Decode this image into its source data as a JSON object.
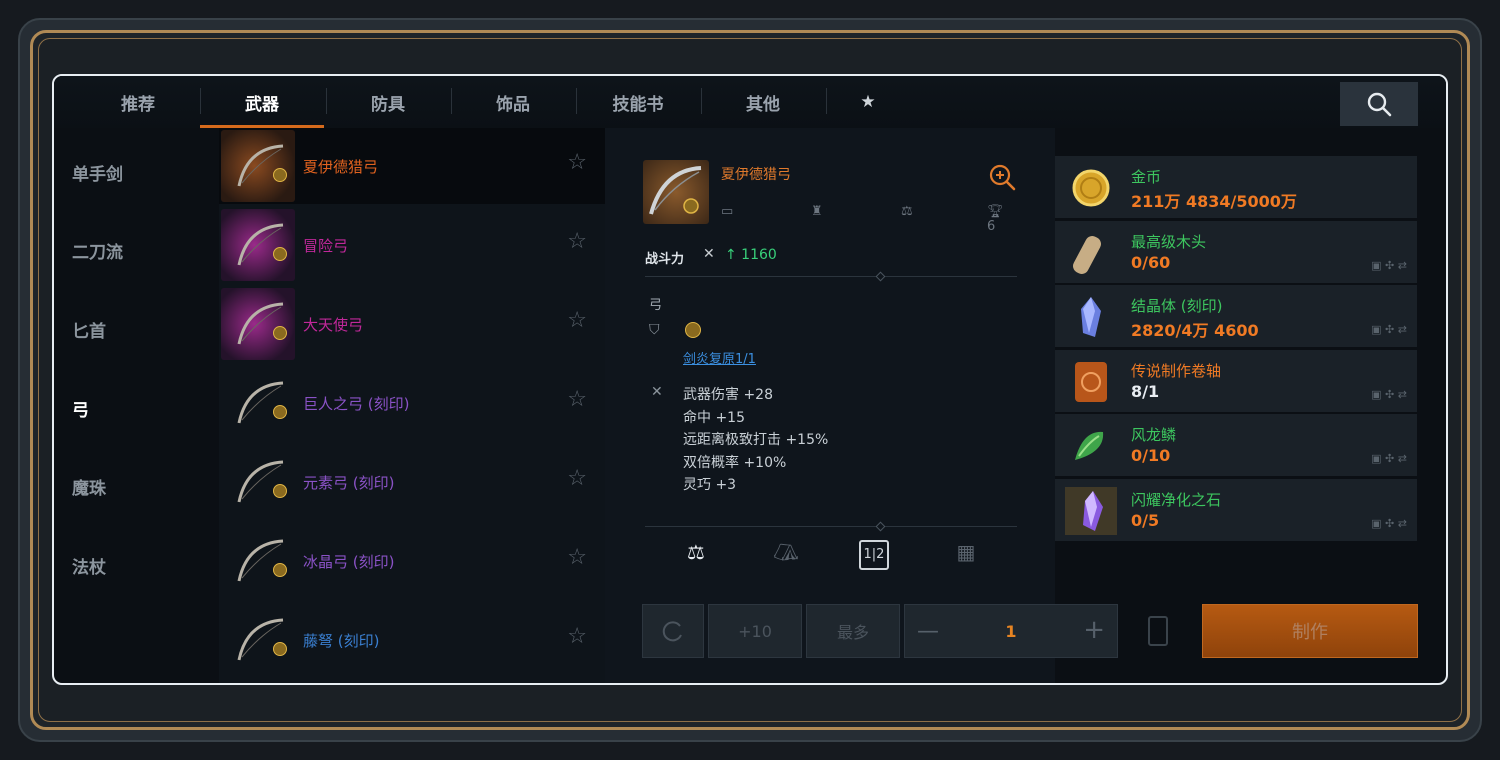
{
  "tabs": [
    {
      "label": "推荐",
      "active": false
    },
    {
      "label": "武器",
      "active": true
    },
    {
      "label": "防具",
      "active": false
    },
    {
      "label": "饰品",
      "active": false
    },
    {
      "label": "技能书",
      "active": false
    },
    {
      "label": "其他",
      "active": false
    },
    {
      "label": "★",
      "active": false,
      "icon": "star-icon"
    }
  ],
  "categories": [
    {
      "label": "单手剑",
      "active": false
    },
    {
      "label": "二刀流",
      "active": false
    },
    {
      "label": "匕首",
      "active": false
    },
    {
      "label": "弓",
      "active": true
    },
    {
      "label": "魔珠",
      "active": false
    },
    {
      "label": "法杖",
      "active": false
    }
  ],
  "items": [
    {
      "name": "夏伊德猎弓",
      "color": "#e0621f",
      "thumb": "orange",
      "selected": true
    },
    {
      "name": "冒险弓",
      "color": "#c0289a",
      "thumb": "pink"
    },
    {
      "name": "大天使弓",
      "color": "#c0289a",
      "thumb": "pink"
    },
    {
      "name": "巨人之弓 (刻印)",
      "color": "#8a52c6",
      "thumb": "dark"
    },
    {
      "name": "元素弓 (刻印)",
      "color": "#8a52c6",
      "thumb": "dark"
    },
    {
      "name": "冰晶弓 (刻印)",
      "color": "#8a52c6",
      "thumb": "dark"
    },
    {
      "name": "藤弩 (刻印)",
      "color": "#3a7fd0",
      "thumb": "dark"
    }
  ],
  "detail": {
    "name": "夏伊德猎弓",
    "icon_text": "6",
    "power_label": "战斗力",
    "power_value": "↑ 1160",
    "type": "弓",
    "engrave_link": "剑炎复原1/1",
    "stats": [
      "武器伤害 +28",
      "命中 +15",
      "远距离极致打击 +15%",
      "双倍概率 +10%",
      "灵巧 +3"
    ],
    "bottom_icons": [
      "balance-icon",
      "tent-icon",
      "compare-icon",
      "grid-icon"
    ]
  },
  "materials": [
    {
      "name": "金币",
      "count": "211万 4834/5000万",
      "name_color": "#3dc65f",
      "icon": "coin"
    },
    {
      "name": "最高级木头",
      "count": "0/60",
      "name_color": "#3dc65f",
      "icon": "wood"
    },
    {
      "name": "结晶体 (刻印)",
      "count": "2820/4万 4600",
      "name_color": "#3dc65f",
      "icon": "crystal"
    },
    {
      "name": "传说制作卷轴",
      "count": "8/1",
      "name_color": "#f07a24",
      "count_color": "#e8edf2",
      "icon": "scroll"
    },
    {
      "name": "风龙鳞",
      "count": "0/10",
      "name_color": "#3dc65f",
      "icon": "scale"
    },
    {
      "name": "闪耀净化之石",
      "count": "0/5",
      "name_color": "#3dc65f",
      "icon": "purple-stone"
    }
  ],
  "controls": {
    "plus10": "+10",
    "max": "最多",
    "quantity": "1",
    "craft": "制作"
  }
}
